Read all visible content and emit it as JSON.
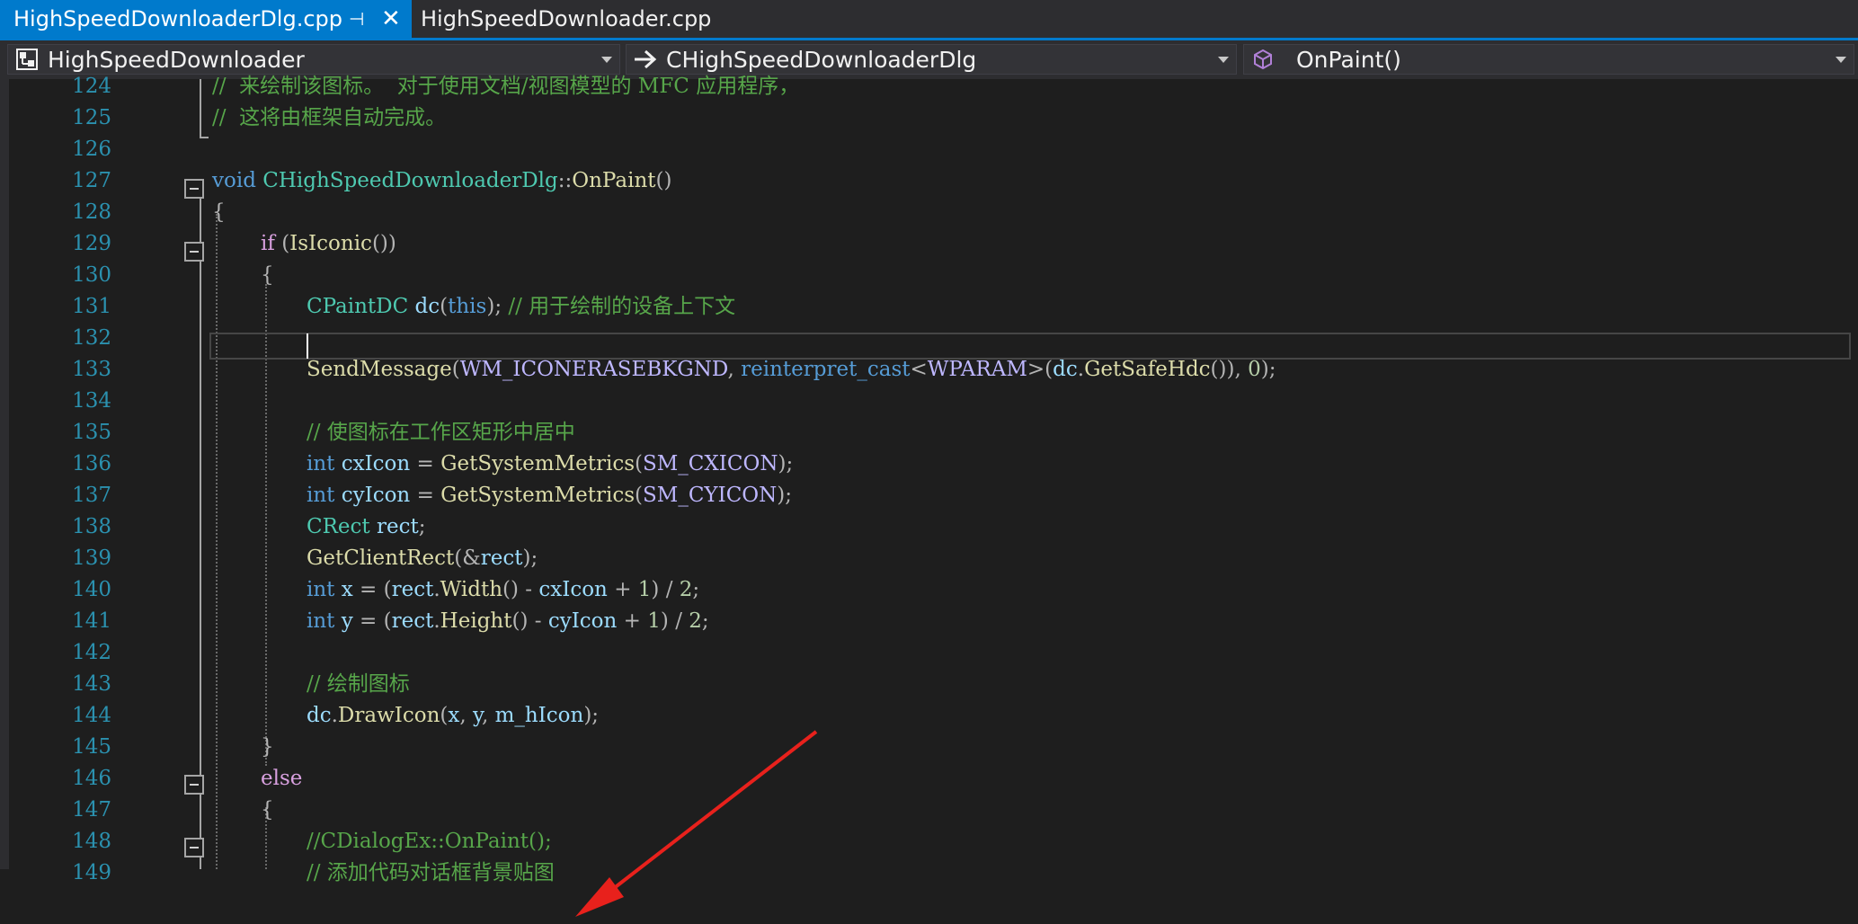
{
  "tabs": [
    {
      "label": "HighSpeedDownloaderDlg.cpp",
      "active": true,
      "pinned_glyph": "⊣",
      "close_glyph": "✕"
    },
    {
      "label": "HighSpeedDownloader.cpp",
      "active": false
    }
  ],
  "navigation": {
    "project": "HighSpeedDownloader",
    "scope": "CHighSpeedDownloaderDlg",
    "member": "OnPaint()"
  },
  "colors": {
    "accent": "#007acc",
    "keyword": "#569cd6",
    "type": "#4ec9b0",
    "function": "#dcdcaa",
    "macro": "#beb7ff",
    "comment": "#57a64a",
    "line_number": "#2b91af",
    "annotation_arrow": "#e8211c"
  },
  "icons": {
    "project": "project-icon",
    "scope": "arrow-right-icon",
    "member": "method-cube-icon",
    "fold": "collapse-minus-icon",
    "pin": "pin-icon",
    "close": "close-icon"
  },
  "editor": {
    "current_line": 132,
    "lines": [
      {
        "n": "124",
        "text": "//  来绘制该图标。  对于使用文档/视图模型的 MFC 应用程序，"
      },
      {
        "n": "125",
        "text": "//  这将由框架自动完成。"
      },
      {
        "n": "126",
        "text": ""
      },
      {
        "n": "127",
        "text": "void CHighSpeedDownloaderDlg::OnPaint()"
      },
      {
        "n": "128",
        "text": "{"
      },
      {
        "n": "129",
        "text": "if (IsIconic())"
      },
      {
        "n": "130",
        "text": "{"
      },
      {
        "n": "131",
        "text": "CPaintDC dc(this); // 用于绘制的设备上下文"
      },
      {
        "n": "132",
        "text": ""
      },
      {
        "n": "133",
        "text": "SendMessage(WM_ICONERASEBKGND, reinterpret_cast<WPARAM>(dc.GetSafeHdc()), 0);"
      },
      {
        "n": "134",
        "text": ""
      },
      {
        "n": "135",
        "text": "// 使图标在工作区矩形中居中"
      },
      {
        "n": "136",
        "text": "int cxIcon = GetSystemMetrics(SM_CXICON);"
      },
      {
        "n": "137",
        "text": "int cyIcon = GetSystemMetrics(SM_CYICON);"
      },
      {
        "n": "138",
        "text": "CRect rect;"
      },
      {
        "n": "139",
        "text": "GetClientRect(&rect);"
      },
      {
        "n": "140",
        "text": "int x = (rect.Width() - cxIcon + 1) / 2;"
      },
      {
        "n": "141",
        "text": "int y = (rect.Height() - cyIcon + 1) / 2;"
      },
      {
        "n": "142",
        "text": ""
      },
      {
        "n": "143",
        "text": "// 绘制图标"
      },
      {
        "n": "144",
        "text": "dc.DrawIcon(x, y, m_hIcon);"
      },
      {
        "n": "145",
        "text": "}"
      },
      {
        "n": "146",
        "text": "else"
      },
      {
        "n": "147",
        "text": "{"
      },
      {
        "n": "148",
        "text": "//CDialogEx::OnPaint();"
      },
      {
        "n": "149",
        "text": "// 添加代码对话框背景贴图"
      }
    ],
    "tokens": {
      "c124": "//  来绘制该图标。  对于使用文档/视图模型的 MFC 应用程序，",
      "c125": "//  这将由框架自动完成。",
      "kw_void": "void",
      "cls_dlg": "CHighSpeedDownloaderDlg",
      "scope_op": "::",
      "fn_onpaint": "OnPaint",
      "paren_empty": "()",
      "brace_open": "{",
      "brace_close": "}",
      "kw_if": "if",
      "paren_open": "(",
      "paren_close": ")",
      "fn_isiconic": "IsIconic",
      "cls_paintdc": "CPaintDC",
      "var_dc": "dc",
      "kw_this": "this",
      "semi": ";",
      "c131": "// 用于绘制的设备上下文",
      "fn_sendmessage": "SendMessage",
      "mac_erase": "WM_ICONERASEBKGND",
      "comma": ",",
      "kw_reinterpret": "reinterpret_cast",
      "lt": "<",
      "gt": ">",
      "mac_wparam": "WPARAM",
      "dot": ".",
      "fn_getsafehdc": "GetSafeHdc",
      "num_0": "0",
      "c135": "// 使图标在工作区矩形中居中",
      "kw_int": "int",
      "var_cxicon": "cxIcon",
      "var_cyicon": "cyIcon",
      "eq": "=",
      "fn_getsysmetrics": "GetSystemMetrics",
      "mac_cxicon": "SM_CXICON",
      "mac_cyicon": "SM_CYICON",
      "cls_crect": "CRect",
      "var_rect": "rect",
      "fn_getclientrect": "GetClientRect",
      "amp": "&",
      "var_x": "x",
      "var_y": "y",
      "fn_width": "Width",
      "fn_height": "Height",
      "minus": "-",
      "plus": "+",
      "num_1": "1",
      "slash": "/",
      "num_2": "2",
      "c143": "// 绘制图标",
      "fn_drawicon": "DrawIcon",
      "var_hicon": "m_hIcon",
      "kw_else": "else",
      "c148": "//CDialogEx::OnPaint();",
      "c149": "// 添加代码对话框背景贴图"
    }
  }
}
